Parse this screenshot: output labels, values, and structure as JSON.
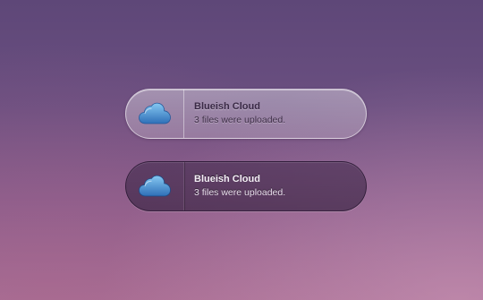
{
  "notifications": [
    {
      "variant": "light",
      "icon": "cloud-icon",
      "title": "Blueish Cloud",
      "message": "3 files were uploaded."
    },
    {
      "variant": "dark",
      "icon": "cloud-icon",
      "title": "Blueish Cloud",
      "message": "3 files were uploaded."
    }
  ],
  "colors": {
    "cloud_light": "#7cc0ee",
    "cloud_dark": "#2f6fb8"
  }
}
